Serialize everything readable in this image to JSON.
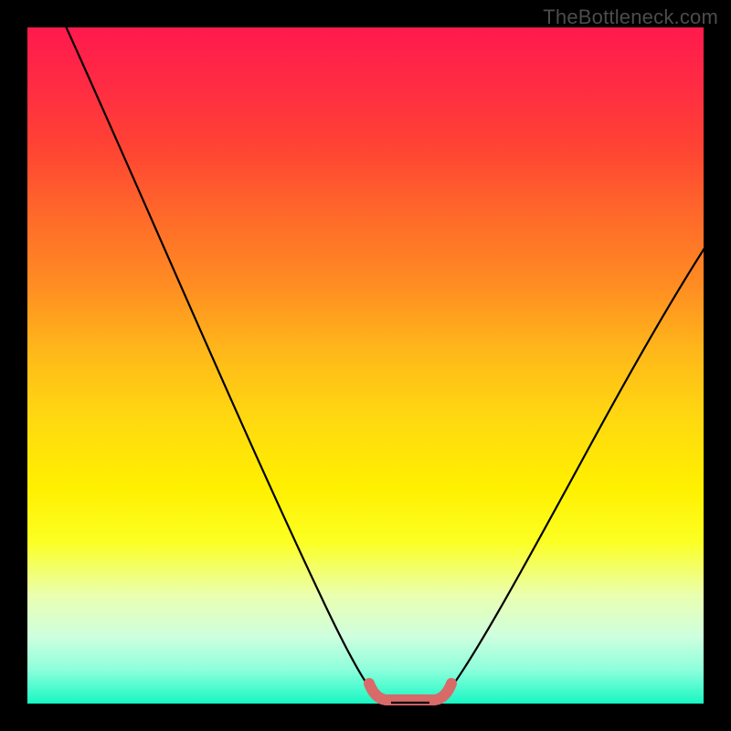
{
  "watermark": "TheBottleneck.com",
  "colors": {
    "background": "#000000",
    "gradient_top": "#ff1a4d",
    "gradient_bottom": "#17f7c3",
    "curve": "#000000",
    "marker": "#d86a6a"
  },
  "chart_data": {
    "type": "line",
    "title": "",
    "xlabel": "",
    "ylabel": "",
    "xlim": [
      0,
      100
    ],
    "ylim": [
      0,
      100
    ],
    "x": [
      5,
      10,
      15,
      20,
      25,
      30,
      35,
      40,
      45,
      48,
      50,
      52,
      55,
      57,
      60,
      62,
      65,
      70,
      75,
      80,
      85,
      90,
      95,
      100
    ],
    "values": [
      100,
      90,
      80,
      69,
      58,
      47,
      36,
      26,
      16,
      10,
      6,
      3,
      1,
      0,
      0,
      2,
      6,
      14,
      22,
      30,
      37,
      44,
      50,
      56
    ],
    "annotations": [
      {
        "label": "flat-minimum-marker",
        "x_start": 50,
        "x_end": 62,
        "y": 0
      }
    ]
  }
}
